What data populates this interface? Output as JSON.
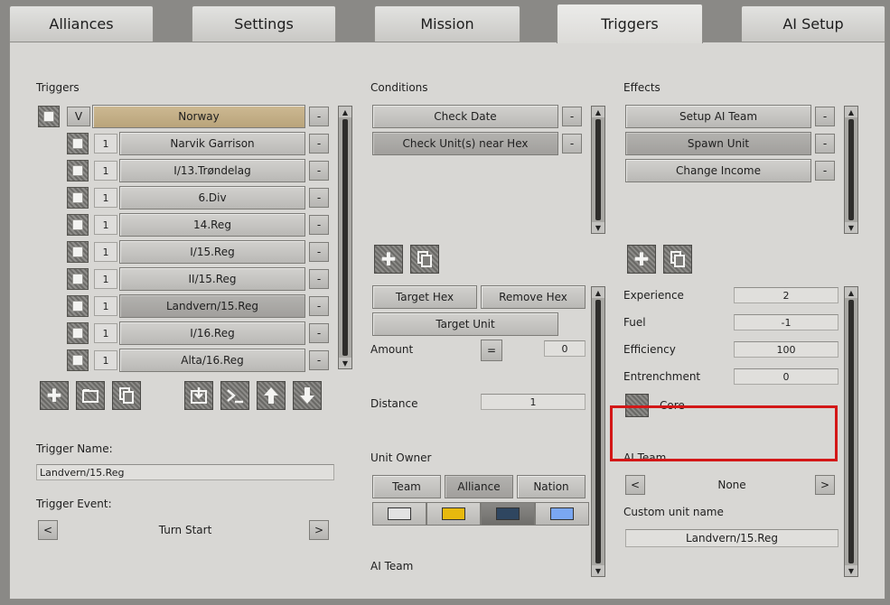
{
  "tabs": [
    "Alliances",
    "Settings",
    "Mission",
    "Triggers",
    "AI Setup"
  ],
  "triggers": {
    "label": "Triggers",
    "group": {
      "flag": "V",
      "name": "Norway",
      "remove": "-"
    },
    "items": [
      {
        "count": "1",
        "name": "Narvik Garrison"
      },
      {
        "count": "1",
        "name": "I/13.Trøndelag"
      },
      {
        "count": "1",
        "name": "6.Div"
      },
      {
        "count": "1",
        "name": "14.Reg"
      },
      {
        "count": "1",
        "name": "I/15.Reg"
      },
      {
        "count": "1",
        "name": "II/15.Reg"
      },
      {
        "count": "1",
        "name": "Landvern/15.Reg"
      },
      {
        "count": "1",
        "name": "I/16.Reg"
      },
      {
        "count": "1",
        "name": "Alta/16.Reg"
      }
    ],
    "remove": "-",
    "name_label": "Trigger Name:",
    "name_value": "Landvern/15.Reg",
    "event_label": "Trigger Event:",
    "event_prev": "<",
    "event_value": "Turn Start",
    "event_next": ">"
  },
  "conditions": {
    "label": "Conditions",
    "items": [
      "Check Date",
      "Check Unit(s) near Hex"
    ],
    "remove": "-",
    "target_hex": "Target Hex",
    "remove_hex": "Remove Hex",
    "target_unit": "Target Unit",
    "amount_label": "Amount",
    "amount_op": "=",
    "amount_value": "0",
    "distance_label": "Distance",
    "distance_value": "1",
    "owner_label": "Unit Owner",
    "owner_options": [
      "Team",
      "Alliance",
      "Nation"
    ],
    "ai_team_label": "AI Team"
  },
  "effects": {
    "label": "Effects",
    "items": [
      "Setup AI Team",
      "Spawn Unit",
      "Change Income"
    ],
    "remove": "-",
    "experience_label": "Experience",
    "experience_value": "2",
    "fuel_label": "Fuel",
    "fuel_value": "-1",
    "efficiency_label": "Efficiency",
    "efficiency_value": "100",
    "entrenchment_label": "Entrenchment",
    "entrenchment_value": "0",
    "core_label": "Core",
    "ai_team_label": "AI Team",
    "ai_prev": "<",
    "ai_value": "None",
    "ai_next": ">",
    "custom_name_label": "Custom unit name",
    "custom_name_value": "Landvern/15.Reg"
  },
  "colors": {
    "highlight": "#d31717",
    "swatch_white": "#e2e2e2",
    "swatch_yellow": "#e7b90e",
    "swatch_navy": "#2f4660",
    "swatch_blue": "#7aa7f2"
  }
}
